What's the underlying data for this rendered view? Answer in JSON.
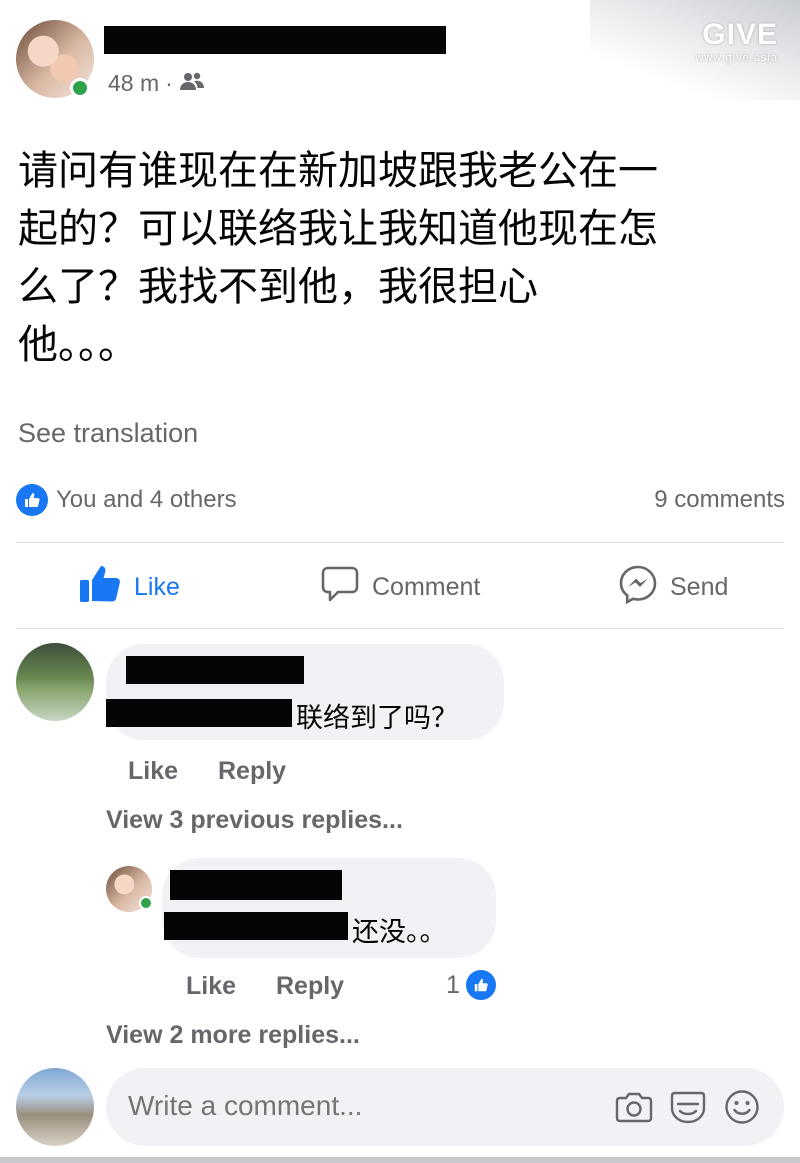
{
  "watermark": {
    "brand": "GIVE",
    "url": "www.give.asia"
  },
  "post": {
    "time": "48 m",
    "separator": "·",
    "audience_icon": "friends-icon",
    "text": "请问有谁现在在新加坡跟我老公在一\n起的？可以联络我让我知道他现在怎\n么了？我找不到他，我很担心\n他。。。",
    "see_translation": "See translation",
    "reactions_summary": "You and 4 others",
    "comments_count": "9 comments"
  },
  "actions": {
    "like": "Like",
    "comment": "Comment",
    "send": "Send"
  },
  "comments": [
    {
      "text": "联络到了吗？",
      "like": "Like",
      "reply": "Reply",
      "view_previous": "View 3 previous replies..."
    },
    {
      "text": "还没。。",
      "like": "Like",
      "reply": "Reply",
      "reaction_count": "1",
      "view_more": "View 2 more replies..."
    }
  ],
  "composer": {
    "placeholder": "Write a comment...",
    "icons": [
      "camera-icon",
      "gif-icon",
      "emoji-icon"
    ]
  },
  "colors": {
    "facebook_blue": "#1877f2",
    "secondary_text": "#65676b",
    "bubble": "#f0f2f5",
    "online": "#31a24c"
  }
}
